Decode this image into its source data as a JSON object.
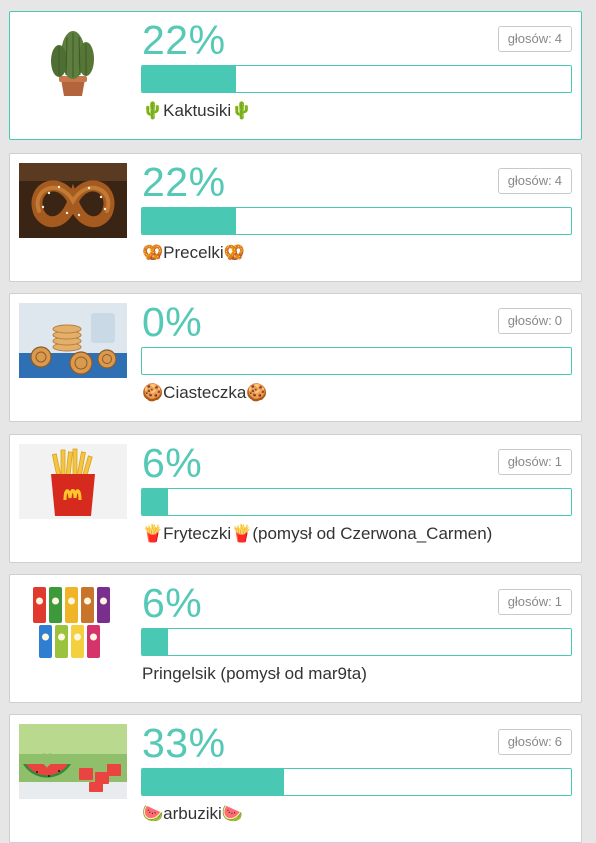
{
  "votes_label": "głosów:",
  "options": [
    {
      "percent": "22%",
      "fill_fraction": 0.22,
      "votes": "4",
      "label": "🌵Kaktusiki🌵",
      "image": "cactus-photo",
      "selected": true
    },
    {
      "percent": "22%",
      "fill_fraction": 0.22,
      "votes": "4",
      "label": "🥨Precelki🥨",
      "image": "pretzel-photo",
      "selected": false
    },
    {
      "percent": "0%",
      "fill_fraction": 0.0,
      "votes": "0",
      "label": "🍪Ciasteczka🍪",
      "image": "cookies-photo",
      "selected": false
    },
    {
      "percent": "6%",
      "fill_fraction": 0.06,
      "votes": "1",
      "label": "🍟Fryteczki🍟(pomysł od Czerwona_Carmen)",
      "image": "fries-photo",
      "selected": false
    },
    {
      "percent": "6%",
      "fill_fraction": 0.06,
      "votes": "1",
      "label": "Pringelsik (pomysł od mar9ta)",
      "image": "pringles-photo",
      "selected": false
    },
    {
      "percent": "33%",
      "fill_fraction": 0.33,
      "votes": "6",
      "label": "🍉arbuziki🍉",
      "image": "watermelon-photo",
      "selected": false
    }
  ],
  "colors": {
    "accent": "#49c9b4",
    "percent_text": "#55c9b6"
  }
}
